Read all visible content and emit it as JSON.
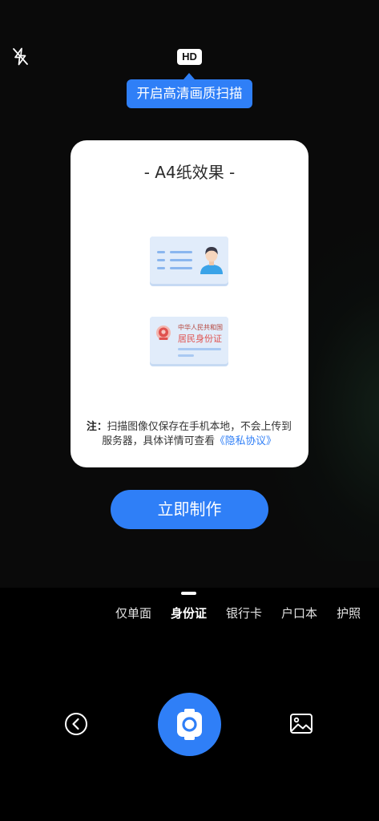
{
  "header": {
    "hd_badge": "HD",
    "hd_tooltip": "开启高清画质扫描"
  },
  "preview_card": {
    "title": "- A4纸效果 -",
    "id_back": {
      "issuer": "中华人民共和国",
      "name": "居民身份证"
    },
    "note": {
      "prefix": "注：",
      "text": "扫描图像仅保存在手机本地，不会上传到服务器，具体详情可查看",
      "link": "《隐私协议》"
    }
  },
  "make_button": {
    "label": "立即制作"
  },
  "mode_tabs": {
    "selected_index": 1,
    "items": [
      {
        "label": "仅单面"
      },
      {
        "label": "身份证"
      },
      {
        "label": "银行卡"
      },
      {
        "label": "户口本"
      },
      {
        "label": "护照"
      }
    ]
  },
  "icons": {
    "flash": "flash-off-icon",
    "back": "back-chevron-icon",
    "shutter": "camera-icon",
    "gallery": "gallery-icon",
    "id_front": "id-card-front-illustration",
    "id_back": "id-card-back-illustration"
  },
  "colors": {
    "accent": "#2f7ff7",
    "background": "#000000",
    "card": "#ffffff",
    "id_card_fill": "#e1ecfa",
    "emblem_red": "#e0524f"
  }
}
